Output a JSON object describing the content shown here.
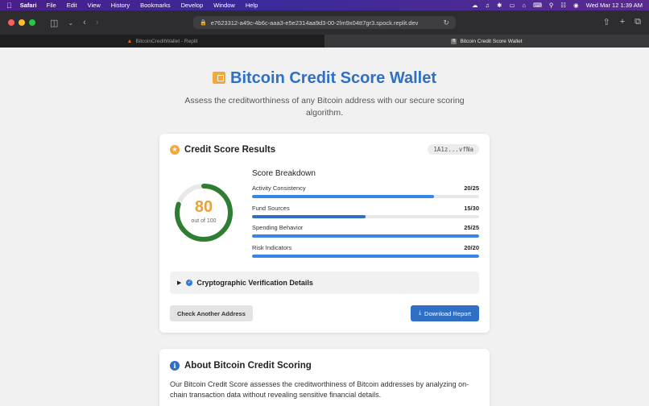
{
  "menubar": {
    "app_name": "Safari",
    "menus": [
      "File",
      "Edit",
      "View",
      "History",
      "Bookmarks",
      "Develop",
      "Window",
      "Help"
    ],
    "clock": "Wed Mar 12  1:39 AM"
  },
  "browser": {
    "url": "e7623312-a49c-4b6c-aaa3-e5e2314aa9d3-00-2lm9x04tt7gr3.spock.replit.dev",
    "tabs": [
      {
        "label": "BitcoinCreditWallet - Replit",
        "active": false
      },
      {
        "label": "Bitcoin Credit Score Wallet",
        "active": true
      }
    ]
  },
  "hero": {
    "title": "Bitcoin Credit Score Wallet",
    "subtitle": "Assess the creditworthiness of any Bitcoin address with our secure scoring algorithm."
  },
  "results": {
    "title": "Credit Score Results",
    "address": "1A1z...vfNa",
    "score": "80",
    "score_max_label": "out of 100",
    "score_fraction": 0.8,
    "breakdown_title": "Score Breakdown",
    "metrics": [
      {
        "label": "Activity Consistency",
        "value": "20/25",
        "fraction": 0.8,
        "color": "#3a86e8"
      },
      {
        "label": "Fund Sources",
        "value": "15/30",
        "fraction": 0.5,
        "color": "#2f6fc4"
      },
      {
        "label": "Spending Behavior",
        "value": "25/25",
        "fraction": 1.0,
        "color": "#3a86e8"
      },
      {
        "label": "Risk Indicators",
        "value": "20/20",
        "fraction": 1.0,
        "color": "#3a86e8"
      }
    ],
    "verification_label": "Cryptographic Verification Details",
    "check_another_label": "Check Another Address",
    "download_label": "Download Report"
  },
  "about": {
    "title": "About Bitcoin Credit Scoring",
    "text": "Our Bitcoin Credit Score assesses the creditworthiness of Bitcoin addresses by analyzing on-chain transaction data without revealing sensitive financial details."
  },
  "colors": {
    "brand_blue": "#2f6fc4",
    "score_orange": "#e9a13a",
    "gauge_green": "#2e7d32"
  }
}
